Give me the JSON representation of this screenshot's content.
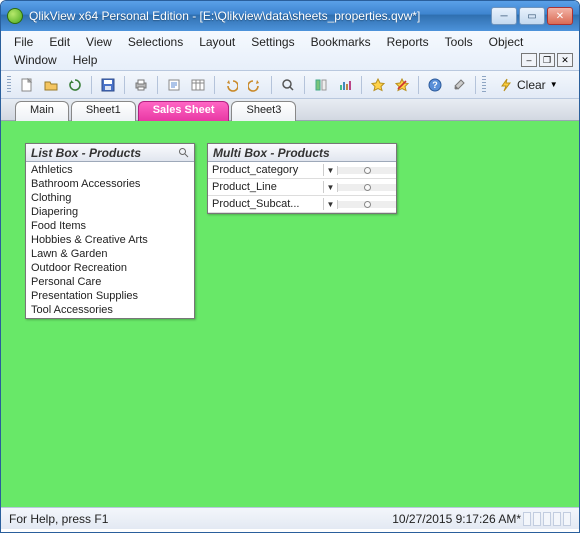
{
  "window": {
    "title": "QlikView x64 Personal Edition - [E:\\Qlikview\\data\\sheets_properties.qvw*]"
  },
  "menu": {
    "row1": [
      "File",
      "Edit",
      "View",
      "Selections",
      "Layout",
      "Settings",
      "Bookmarks",
      "Reports",
      "Tools",
      "Object"
    ],
    "row2": [
      "Window",
      "Help"
    ]
  },
  "toolbar": {
    "clear_label": "Clear"
  },
  "tabs": [
    {
      "label": "Main",
      "active": false
    },
    {
      "label": "Sheet1",
      "active": false
    },
    {
      "label": "Sales Sheet",
      "active": true
    },
    {
      "label": "Sheet3",
      "active": false
    }
  ],
  "listbox": {
    "title": "List Box - Products",
    "items": [
      "Athletics",
      "Bathroom Accessories",
      "Clothing",
      "Diapering",
      "Food Items",
      "Hobbies & Creative Arts",
      "Lawn & Garden",
      "Outdoor Recreation",
      "Personal Care",
      "Presentation Supplies",
      "Tool Accessories"
    ]
  },
  "multibox": {
    "title": "Multi Box - Products",
    "rows": [
      "Product_category",
      "Product_Line",
      "Product_Subcat..."
    ]
  },
  "statusbar": {
    "help": "For Help, press F1",
    "timestamp": "10/27/2015 9:17:26 AM*"
  }
}
